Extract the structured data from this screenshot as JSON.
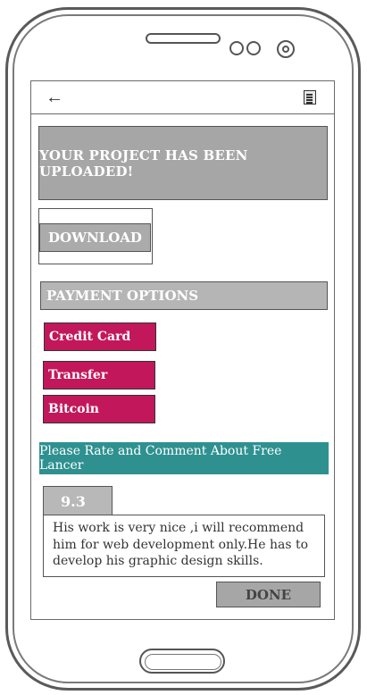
{
  "top_bar": {
    "back_icon": "arrow-left-icon",
    "menu_icon": "document-menu-icon"
  },
  "banner": {
    "text": "YOUR PROJECT HAS BEEN UPLOADED!"
  },
  "download": {
    "label": "DOWNLOAD"
  },
  "payment": {
    "header": "PAYMENT OPTIONS",
    "options": [
      "Credit Card",
      "Transfer",
      "Bitcoin"
    ],
    "button_color": "#c2185b"
  },
  "rating": {
    "prompt": "Please Rate and Comment About Free Lancer",
    "prompt_color": "#2e9190",
    "score": "9.3",
    "comment": "His work is very nice ,i will recommend him for web development only.He has to develop his graphic design skills."
  },
  "done": {
    "label": "DONE"
  }
}
